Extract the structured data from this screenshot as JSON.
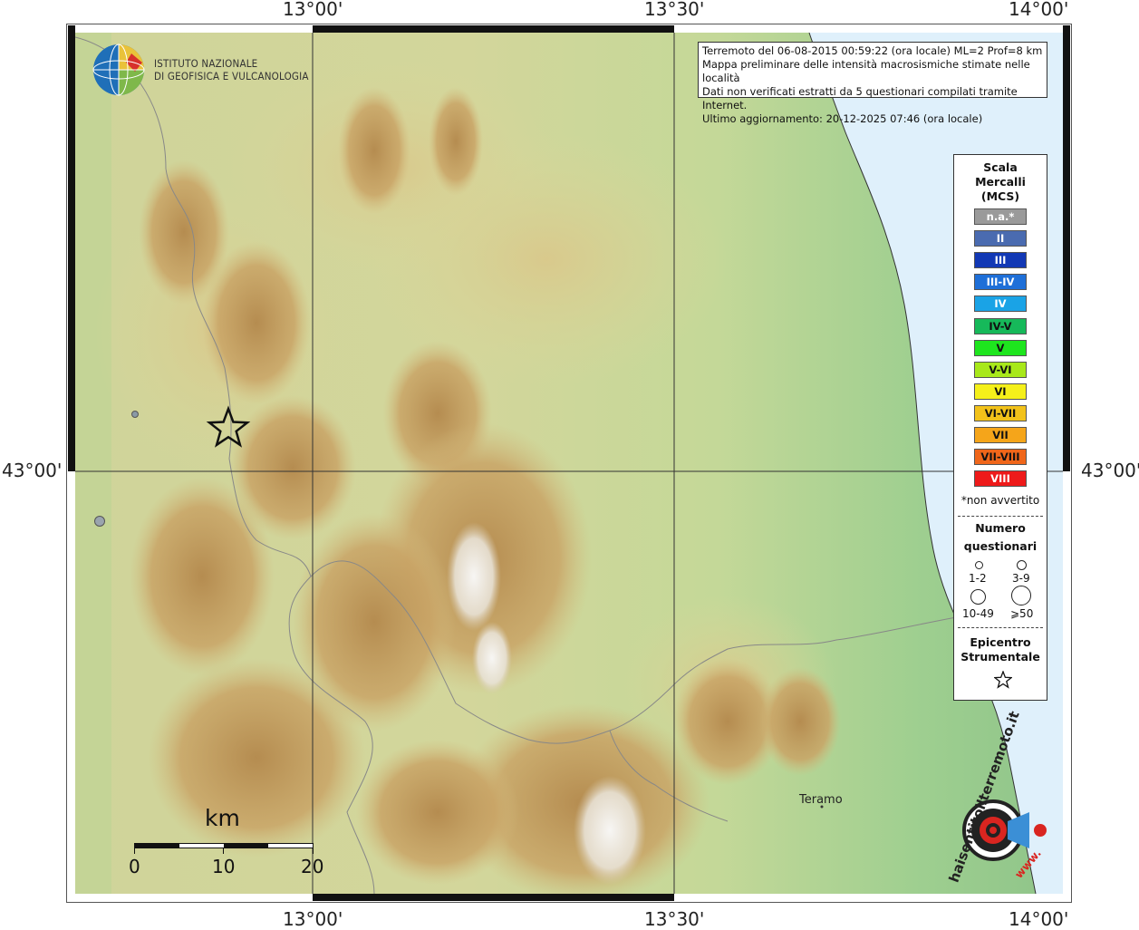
{
  "coords": {
    "top": [
      "13°00'",
      "13°30'",
      "14°00'"
    ],
    "bottom": [
      "13°00'",
      "13°30'",
      "14°00'"
    ],
    "left": "43°00'",
    "right": "43°00'"
  },
  "institute": {
    "line1": "ISTITUTO NAZIONALE",
    "line2": "DI GEOFISICA E VULCANOLOGIA"
  },
  "info": {
    "line1": "Terremoto del 06-08-2015 00:59:22 (ora locale) ML=2 Prof=8 km",
    "line2": "Mappa preliminare delle intensità macrosismiche stimate nelle località",
    "line3": "Dati non verificati estratti da 5 questionari compilati tramite Internet.",
    "line4": "Ultimo aggiornamento: 20-12-2025 07:46 (ora locale)"
  },
  "legend": {
    "title": [
      "Scala",
      "Mercalli",
      "(MCS)"
    ],
    "levels": [
      {
        "label": "n.a.*",
        "color": "#9a9a9a",
        "text": "#ffffff"
      },
      {
        "label": "II",
        "color": "#4a6bb0",
        "text": "#ffffff"
      },
      {
        "label": "III",
        "color": "#1238b5",
        "text": "#ffffff"
      },
      {
        "label": "III-IV",
        "color": "#1e6fd8",
        "text": "#ffffff"
      },
      {
        "label": "IV",
        "color": "#1aa3e6",
        "text": "#ffffff"
      },
      {
        "label": "IV-V",
        "color": "#16b95a",
        "text": "#111111"
      },
      {
        "label": "V",
        "color": "#1ee51e",
        "text": "#111111"
      },
      {
        "label": "V-VI",
        "color": "#a8e81a",
        "text": "#111111"
      },
      {
        "label": "VI",
        "color": "#f5f01a",
        "text": "#111111"
      },
      {
        "label": "VI-VII",
        "color": "#f2c21a",
        "text": "#111111"
      },
      {
        "label": "VII",
        "color": "#f5a51a",
        "text": "#111111"
      },
      {
        "label": "VII-VIII",
        "color": "#f0661a",
        "text": "#111111"
      },
      {
        "label": "VIII",
        "color": "#ee1a1a",
        "text": "#ffffff"
      }
    ],
    "note": "*non avvertito",
    "numero_title": [
      "Numero",
      "questionari"
    ],
    "sizes": [
      "1-2",
      "3-9",
      "10-49",
      "⩾50"
    ],
    "epicentro_title": [
      "Epicentro",
      "Strumentale"
    ]
  },
  "scale": {
    "unit": "km",
    "ticks": [
      "0",
      "10",
      "20"
    ]
  },
  "places": {
    "teramo": "Teramo"
  },
  "watermark": {
    "text": "haisentitoilterremoto.it",
    "www": "www."
  },
  "colors": {
    "sea": "#dff0fb",
    "lowland": "#a9cf8f",
    "hills": "#d8d89a",
    "mountains": "#c09a5a",
    "peaks": "#f2f2f2"
  }
}
